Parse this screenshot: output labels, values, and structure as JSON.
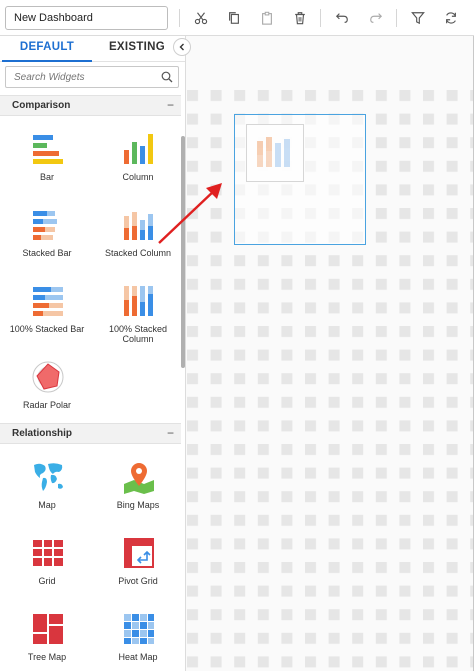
{
  "toolbar": {
    "dashboard_name": "New Dashboard",
    "buttons": [
      "cut-icon",
      "copy-icon",
      "paste-icon",
      "delete-icon",
      "undo-icon",
      "redo-icon",
      "filter-icon",
      "refresh-icon"
    ]
  },
  "panel": {
    "tabs": [
      {
        "label": "DEFAULT",
        "active": true
      },
      {
        "label": "EXISTING",
        "active": false
      }
    ],
    "search_placeholder": "Search Widgets",
    "sections": [
      {
        "title": "Comparison",
        "widgets": [
          {
            "label": "Bar",
            "icon": "bar-chart-icon"
          },
          {
            "label": "Column",
            "icon": "column-chart-icon"
          },
          {
            "label": "Stacked Bar",
            "icon": "stacked-bar-icon"
          },
          {
            "label": "Stacked Column",
            "icon": "stacked-column-icon"
          },
          {
            "label": "100% Stacked Bar",
            "icon": "stacked-bar-100-icon"
          },
          {
            "label": "100% Stacked Column",
            "icon": "stacked-column-100-icon"
          },
          {
            "label": "Radar Polar",
            "icon": "radar-polar-icon"
          }
        ]
      },
      {
        "title": "Relationship",
        "widgets": [
          {
            "label": "Map",
            "icon": "map-icon"
          },
          {
            "label": "Bing Maps",
            "icon": "bing-maps-icon"
          },
          {
            "label": "Grid",
            "icon": "grid-icon"
          },
          {
            "label": "Pivot Grid",
            "icon": "pivot-grid-icon"
          },
          {
            "label": "Tree Map",
            "icon": "tree-map-icon"
          },
          {
            "label": "Heat Map",
            "icon": "heat-map-icon"
          }
        ]
      }
    ]
  },
  "colors": {
    "accent": "#1d6fd1",
    "drop_border": "#4aa3e0",
    "arrow": "#e02020",
    "yellow": "#f2c811",
    "green": "#5cb85c",
    "blue": "#3a8ee6",
    "orange": "#ee6b33",
    "peach": "#f5c6a5",
    "red": "#d9363e"
  }
}
